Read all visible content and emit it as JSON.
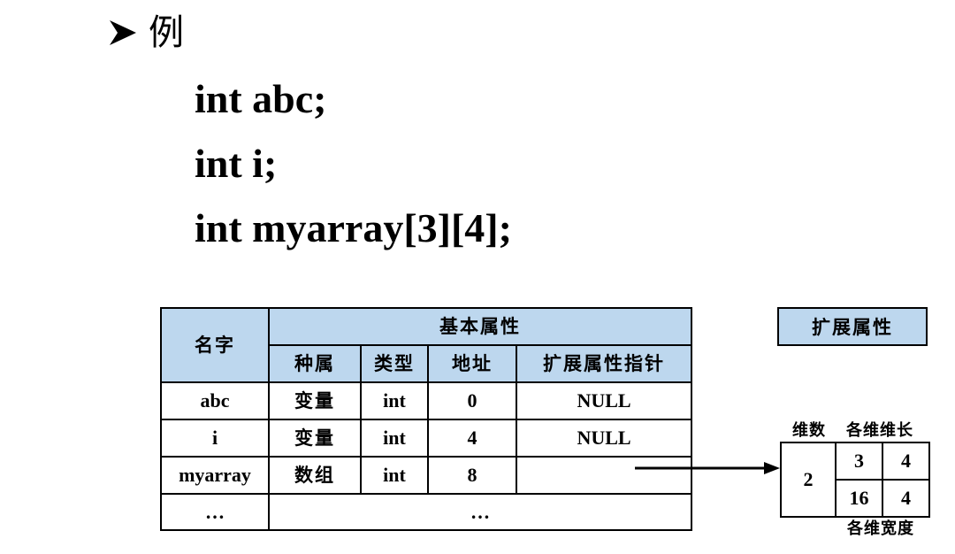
{
  "heading": {
    "icon": "arrow-right-icon",
    "title": "例"
  },
  "code_lines": [
    "int abc;",
    "int i;",
    "int myarray[3][4];"
  ],
  "symbol_table": {
    "name_header": "名字",
    "basic_header": "基本属性",
    "columns": [
      "种属",
      "类型",
      "地址",
      "扩展属性指针"
    ],
    "rows": [
      {
        "name": "abc",
        "kind": "变量",
        "type": "int",
        "address": "0",
        "ext_ptr": "NULL"
      },
      {
        "name": "i",
        "kind": "变量",
        "type": "int",
        "address": "4",
        "ext_ptr": "NULL"
      },
      {
        "name": "myarray",
        "kind": "数组",
        "type": "int",
        "address": "8",
        "ext_ptr": ""
      },
      {
        "name": "…",
        "merged": "…"
      }
    ],
    "header_color": "#bdd7ee"
  },
  "extended": {
    "title": "扩展属性",
    "dims_label": "维数",
    "lengths_label": "各维维长",
    "widths_label": "各维宽度",
    "dims": "2",
    "cells": [
      [
        "3",
        "4"
      ],
      [
        "16",
        "4"
      ]
    ]
  }
}
